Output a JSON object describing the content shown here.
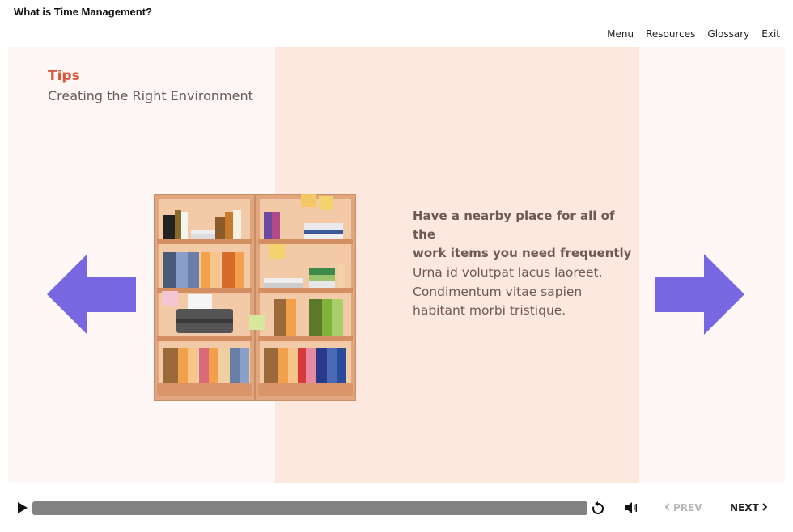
{
  "header": {
    "course_title": "What is Time Management?",
    "nav": [
      "Menu",
      "Resources",
      "Glossary",
      "Exit"
    ]
  },
  "slide": {
    "tips_title": "Tips",
    "tips_subtitle": "Creating the Right Environment",
    "heading_line1": "Have a nearby place for all of the",
    "heading_line2": "work items you need frequently",
    "body_line1": "Urna id volutpat lacus laoreet.",
    "body_line2": "Condimentum vitae sapien",
    "body_line3": "habitant morbi tristique."
  },
  "player": {
    "prev_label": "PREV",
    "next_label": "NEXT",
    "progress": 1.0
  },
  "icons": {
    "arrow_color": "#7767e0",
    "accent": "#d9583c"
  }
}
